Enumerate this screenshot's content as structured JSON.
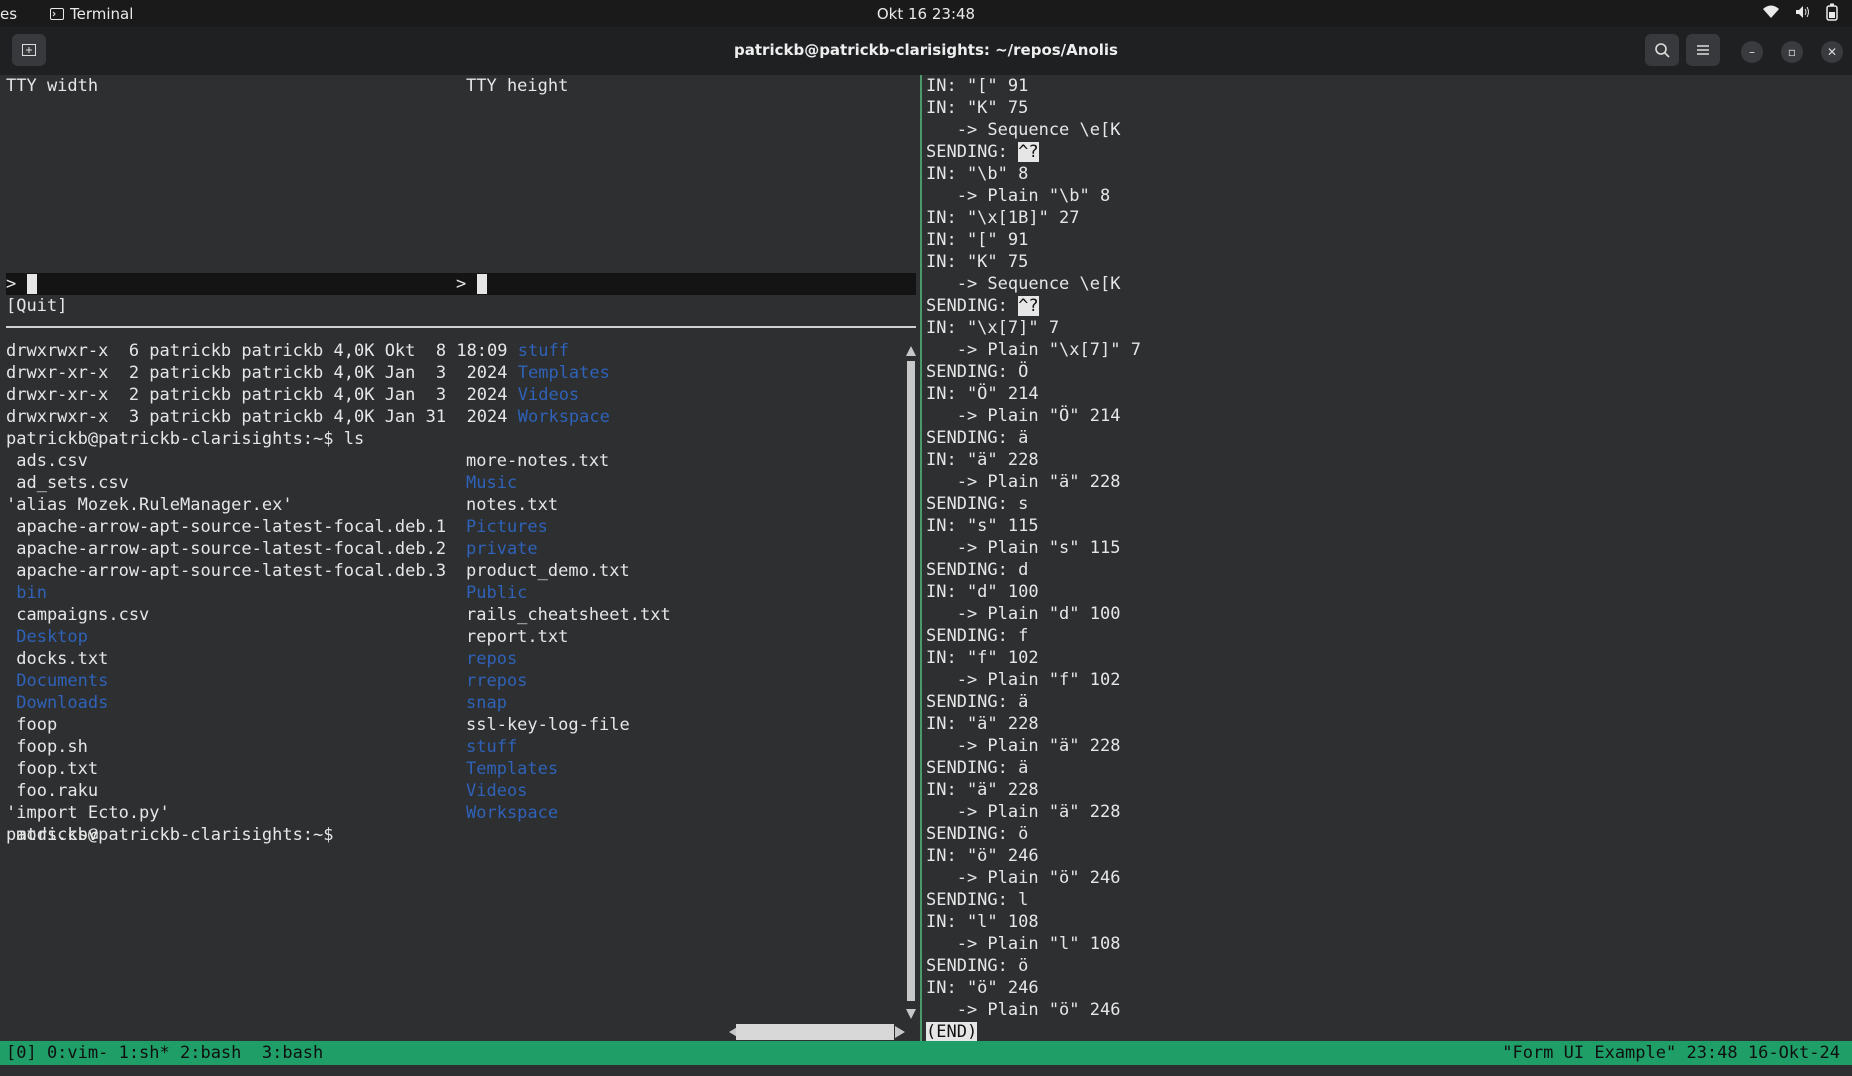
{
  "system_bar": {
    "activities": "es",
    "app_name": "Terminal",
    "clock": "Okt 16  23:48"
  },
  "window": {
    "title": "patrickb@patrickb-clarisights: ~/repos/Anolis"
  },
  "top_left_pane": {
    "label_width": "TTY width",
    "label_height": "TTY height",
    "prompt_left": ">",
    "prompt_right": ">",
    "quit_button": "[Quit]"
  },
  "bottom_left_pane": {
    "long_listing": [
      {
        "perms": "drwxrwxr-x  6 patrickb patrickb 4,0K Okt  8 18:09 ",
        "name": "stuff"
      },
      {
        "perms": "drwxr-xr-x  2 patrickb patrickb 4,0K Jan  3  2024 ",
        "name": "Templates"
      },
      {
        "perms": "drwxr-xr-x  2 patrickb patrickb 4,0K Jan  3  2024 ",
        "name": "Videos"
      },
      {
        "perms": "drwxrwxr-x  3 patrickb patrickb 4,0K Jan 31  2024 ",
        "name": "Workspace"
      }
    ],
    "ls_command": "patrickb@patrickb-clarisights:~$ ls",
    "col1": [
      {
        "t": " ads.csv",
        "dir": false
      },
      {
        "t": " ad_sets.csv",
        "dir": false
      },
      {
        "t": "'alias Mozek.RuleManager.ex'",
        "dir": false
      },
      {
        "t": " apache-arrow-apt-source-latest-focal.deb.1",
        "dir": false
      },
      {
        "t": " apache-arrow-apt-source-latest-focal.deb.2",
        "dir": false
      },
      {
        "t": " apache-arrow-apt-source-latest-focal.deb.3",
        "dir": false
      },
      {
        "t": " bin",
        "dir": true
      },
      {
        "t": " campaigns.csv",
        "dir": false
      },
      {
        "t": " Desktop",
        "dir": true
      },
      {
        "t": " docks.txt",
        "dir": false
      },
      {
        "t": " Documents",
        "dir": true
      },
      {
        "t": " Downloads",
        "dir": true
      },
      {
        "t": " foop",
        "dir": false
      },
      {
        "t": " foop.sh",
        "dir": false
      },
      {
        "t": " foop.txt",
        "dir": false
      },
      {
        "t": " foo.raku",
        "dir": false
      },
      {
        "t": "'import Ecto.py'",
        "dir": false
      },
      {
        "t": " mods.csv",
        "dir": false
      }
    ],
    "col2": [
      {
        "t": "more-notes.txt",
        "dir": false
      },
      {
        "t": "Music",
        "dir": true
      },
      {
        "t": "notes.txt",
        "dir": false
      },
      {
        "t": "Pictures",
        "dir": true
      },
      {
        "t": "private",
        "dir": true
      },
      {
        "t": "product_demo.txt",
        "dir": false
      },
      {
        "t": "Public",
        "dir": true
      },
      {
        "t": "rails_cheatsheet.txt",
        "dir": false
      },
      {
        "t": "report.txt",
        "dir": false
      },
      {
        "t": "repos",
        "dir": true
      },
      {
        "t": "rrepos",
        "dir": true
      },
      {
        "t": "snap",
        "dir": true
      },
      {
        "t": "ssl-key-log-file",
        "dir": false
      },
      {
        "t": "stuff",
        "dir": true
      },
      {
        "t": "Templates",
        "dir": true
      },
      {
        "t": "Videos",
        "dir": true
      },
      {
        "t": "Workspace",
        "dir": true
      }
    ],
    "final_prompt": "patrickb@patrickb-clarisights:~$"
  },
  "right_pane": {
    "lines": [
      "IN: \"[\" 91",
      "IN: \"K\" 75",
      "   -> Sequence \\e[K",
      "SENDING: §^?",
      "IN: \"\\b\" 8",
      "   -> Plain \"\\b\" 8",
      "IN: \"\\x[1B]\" 27",
      "IN: \"[\" 91",
      "IN: \"K\" 75",
      "   -> Sequence \\e[K",
      "SENDING: §^?",
      "IN: \"\\x[7]\" 7",
      "   -> Plain \"\\x[7]\" 7",
      "SENDING: Ö",
      "IN: \"Ö\" 214",
      "   -> Plain \"Ö\" 214",
      "SENDING: ä",
      "IN: \"ä\" 228",
      "   -> Plain \"ä\" 228",
      "SENDING: s",
      "IN: \"s\" 115",
      "   -> Plain \"s\" 115",
      "SENDING: d",
      "IN: \"d\" 100",
      "   -> Plain \"d\" 100",
      "SENDING: f",
      "IN: \"f\" 102",
      "   -> Plain \"f\" 102",
      "SENDING: ä",
      "IN: \"ä\" 228",
      "   -> Plain \"ä\" 228",
      "SENDING: ä",
      "IN: \"ä\" 228",
      "   -> Plain \"ä\" 228",
      "SENDING: ö",
      "IN: \"ö\" 246",
      "   -> Plain \"ö\" 246",
      "SENDING: l",
      "IN: \"l\" 108",
      "   -> Plain \"l\" 108",
      "SENDING: ö",
      "IN: \"ö\" 246",
      "   -> Plain \"ö\" 246"
    ],
    "end_marker": "(END)"
  },
  "status_bar": {
    "windows": "[0] 0:vim- 1:sh* 2:bash  3:bash",
    "right": "\"Form UI Example\" 23:48 16-Okt-24"
  },
  "colors": {
    "directory": "#2f62b8",
    "status_bar": "#1f9e68",
    "pane_divider": "#4a9a6a"
  }
}
